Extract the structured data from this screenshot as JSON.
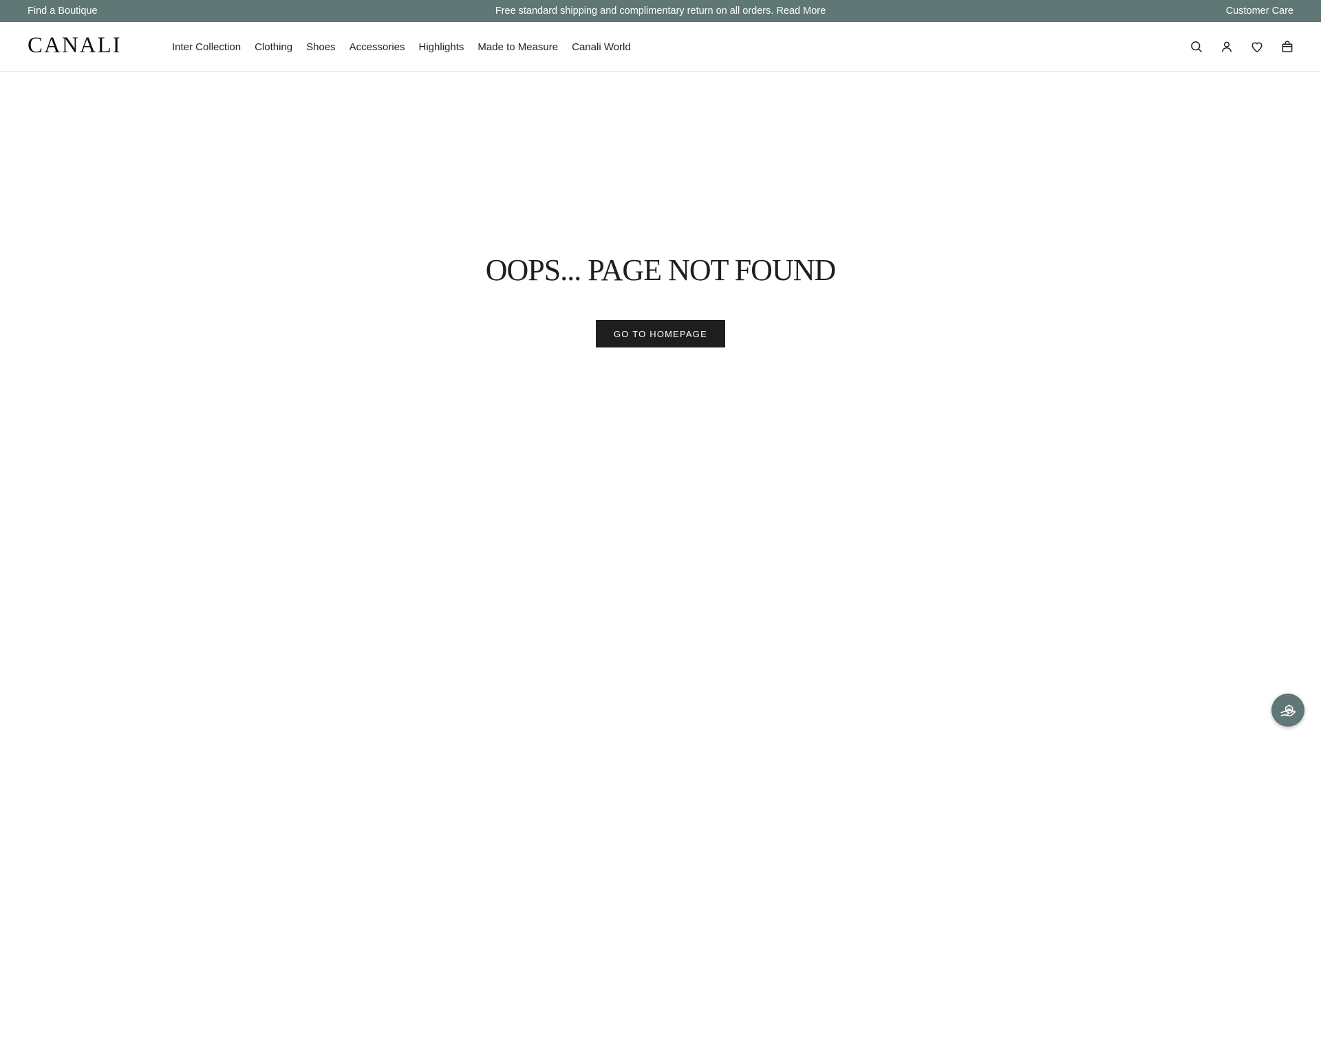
{
  "topbar": {
    "find_boutique": "Find a Boutique",
    "promo_text": "Free standard shipping and complimentary return on all orders.",
    "read_more": "Read More",
    "customer_care": "Customer Care",
    "background_color": "#5f7775"
  },
  "header": {
    "logo": "CANALI",
    "nav": [
      {
        "label": "Inter Collection"
      },
      {
        "label": "Clothing"
      },
      {
        "label": "Shoes"
      },
      {
        "label": "Accessories"
      },
      {
        "label": "Highlights"
      },
      {
        "label": "Made to Measure"
      },
      {
        "label": "Canali World"
      }
    ],
    "icons": [
      "search-icon",
      "account-icon",
      "wishlist-heart-icon",
      "shopping-bag-icon"
    ]
  },
  "main": {
    "title": "OOPS... PAGE NOT FOUND",
    "home_button": "GO TO HOMEPAGE",
    "button_color": "#1e1e1e"
  },
  "floating": {
    "icon": "customer-service-hand-icon",
    "color": "#5f7775"
  }
}
